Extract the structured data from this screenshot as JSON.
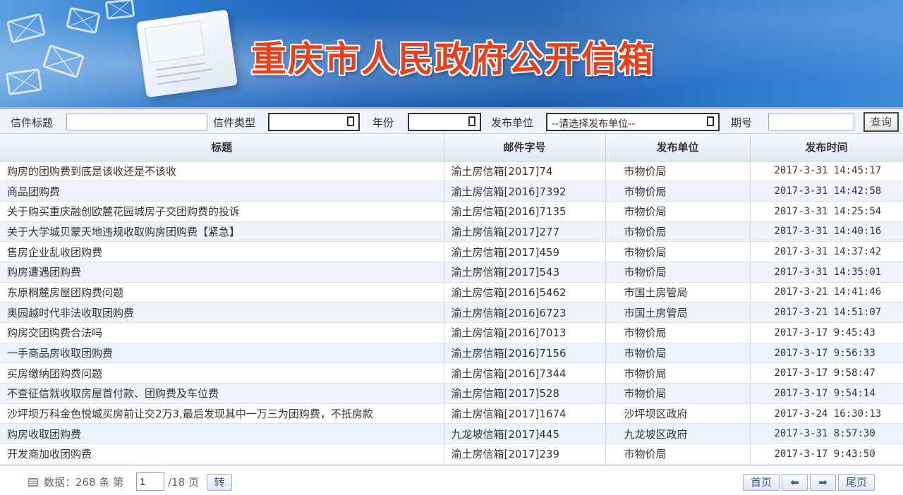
{
  "banner": {
    "title": "重庆市人民政府公开信箱"
  },
  "filters": {
    "title_label": "信件标题",
    "title_value": "",
    "type_label": "信件类型",
    "type_value": "",
    "year_label": "年份",
    "year_value": "",
    "dept_label": "发布单位",
    "dept_value": "--请选择发布单位--",
    "issue_label": "期号",
    "issue_value": "",
    "query_button": "查询"
  },
  "table": {
    "columns": [
      "标题",
      "邮件字号",
      "发布单位",
      "发布时间"
    ],
    "rows": [
      {
        "title": "购房的团购费到底是该收还是不该收",
        "code": "渝土房信箱[2017]74",
        "dept": "市物价局",
        "time": "2017-3-31 14:45:17"
      },
      {
        "title": "商品团购费",
        "code": "渝土房信箱[2016]7392",
        "dept": "市物价局",
        "time": "2017-3-31 14:42:58"
      },
      {
        "title": "关于购买重庆融创欧麓花园城房子交团购费的投诉",
        "code": "渝土房信箱[2016]7135",
        "dept": "市物价局",
        "time": "2017-3-31 14:25:54"
      },
      {
        "title": "关于大学城贝蒙天地违规收取购房团购费【紧急】",
        "code": "渝土房信箱[2017]277",
        "dept": "市物价局",
        "time": "2017-3-31 14:40:16"
      },
      {
        "title": "售房企业乱收团购费",
        "code": "渝土房信箱[2017]459",
        "dept": "市物价局",
        "time": "2017-3-31 14:37:42"
      },
      {
        "title": "购房遭遇团购费",
        "code": "渝土房信箱[2017]543",
        "dept": "市物价局",
        "time": "2017-3-31 14:35:01"
      },
      {
        "title": "东原桐麓房屋团购费问题",
        "code": "渝土房信箱[2016]5462",
        "dept": "市国土房管局",
        "time": "2017-3-21 14:41:46"
      },
      {
        "title": "奥园越时代非法收取团购费",
        "code": "渝土房信箱[2016]6723",
        "dept": "市国土房管局",
        "time": "2017-3-21 14:51:07"
      },
      {
        "title": "购房交团购费合法吗",
        "code": "渝土房信箱[2016]7013",
        "dept": "市物价局",
        "time": "2017-3-17 9:45:43"
      },
      {
        "title": "一手商品房收取团购费",
        "code": "渝土房信箱[2016]7156",
        "dept": "市物价局",
        "time": "2017-3-17 9:56:33"
      },
      {
        "title": "买房缴纳团购费问题",
        "code": "渝土房信箱[2016]7344",
        "dept": "市物价局",
        "time": "2017-3-17 9:58:47"
      },
      {
        "title": "不查征信就收取房屋首付款、团购费及车位费",
        "code": "渝土房信箱[2017]528",
        "dept": "市物价局",
        "time": "2017-3-17 9:54:14"
      },
      {
        "title": "沙坪坝万科金色悦城买房前让交2万3,最后发现其中一万三为团购费，不抵房款",
        "code": "渝土房信箱[2017]1674",
        "dept": "沙坪坝区政府",
        "time": "2017-3-24 16:30:13"
      },
      {
        "title": "购房收取团购费",
        "code": "九龙坡信箱[2017]445",
        "dept": "九龙坡区政府",
        "time": "2017-3-31 8:57:30"
      },
      {
        "title": "开发商加收团购费",
        "code": "渝土房信箱[2017]239",
        "dept": "市物价局",
        "time": "2017-3-17 9:43:50"
      }
    ]
  },
  "pager": {
    "data_label": "数据：268 条 第",
    "page_value": "1",
    "total_label": "/18 页",
    "go_button": "转",
    "first_button": "首页",
    "prev_icon": "arrow-left-icon",
    "next_icon": "arrow-right-icon",
    "last_button": "尾页"
  }
}
